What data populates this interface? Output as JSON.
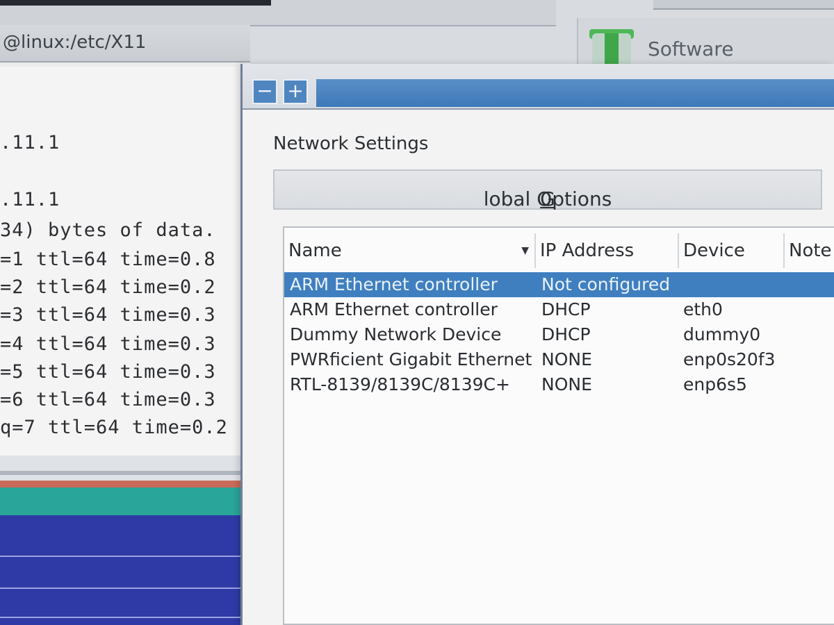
{
  "terminal": {
    "title": "@linux:/etc/X11",
    "lines": [
      ".11.1",
      ".11.1",
      "34) bytes of data.",
      "=1 ttl=64 time=0.8",
      "=2 ttl=64 time=0.2",
      "=3 ttl=64 time=0.3",
      "=4 ttl=64 time=0.3",
      "=5 ttl=64 time=0.3",
      "=6 ttl=64 time=0.3",
      "q=7 ttl=64 time=0.2"
    ]
  },
  "background": {
    "software_label": "Software",
    "software_icon": "package-icon"
  },
  "dialog": {
    "minimize_icon": "minus-icon",
    "maximize_icon": "plus-icon",
    "heading": "Network Settings",
    "tab_prefix": "G",
    "tab_rest": "lobal Options",
    "columns": {
      "name": "Name",
      "ip": "IP Address",
      "device": "Device",
      "note": "Note"
    },
    "sort_indicator": "▼",
    "rows": [
      {
        "name": "ARM Ethernet controller",
        "ip": "Not configured",
        "device": "",
        "selected": true
      },
      {
        "name": "ARM Ethernet controller",
        "ip": "DHCP",
        "device": "eth0",
        "selected": false
      },
      {
        "name": "Dummy Network Device",
        "ip": "DHCP",
        "device": "dummy0",
        "selected": false
      },
      {
        "name": "PWRficient Gigabit Ethernet",
        "ip": "NONE",
        "device": "enp0s20f3",
        "selected": false
      },
      {
        "name": "RTL-8139/8139C/8139C+",
        "ip": "NONE",
        "device": "enp6s5",
        "selected": false
      }
    ],
    "selection_color": "#3f7fc0"
  }
}
